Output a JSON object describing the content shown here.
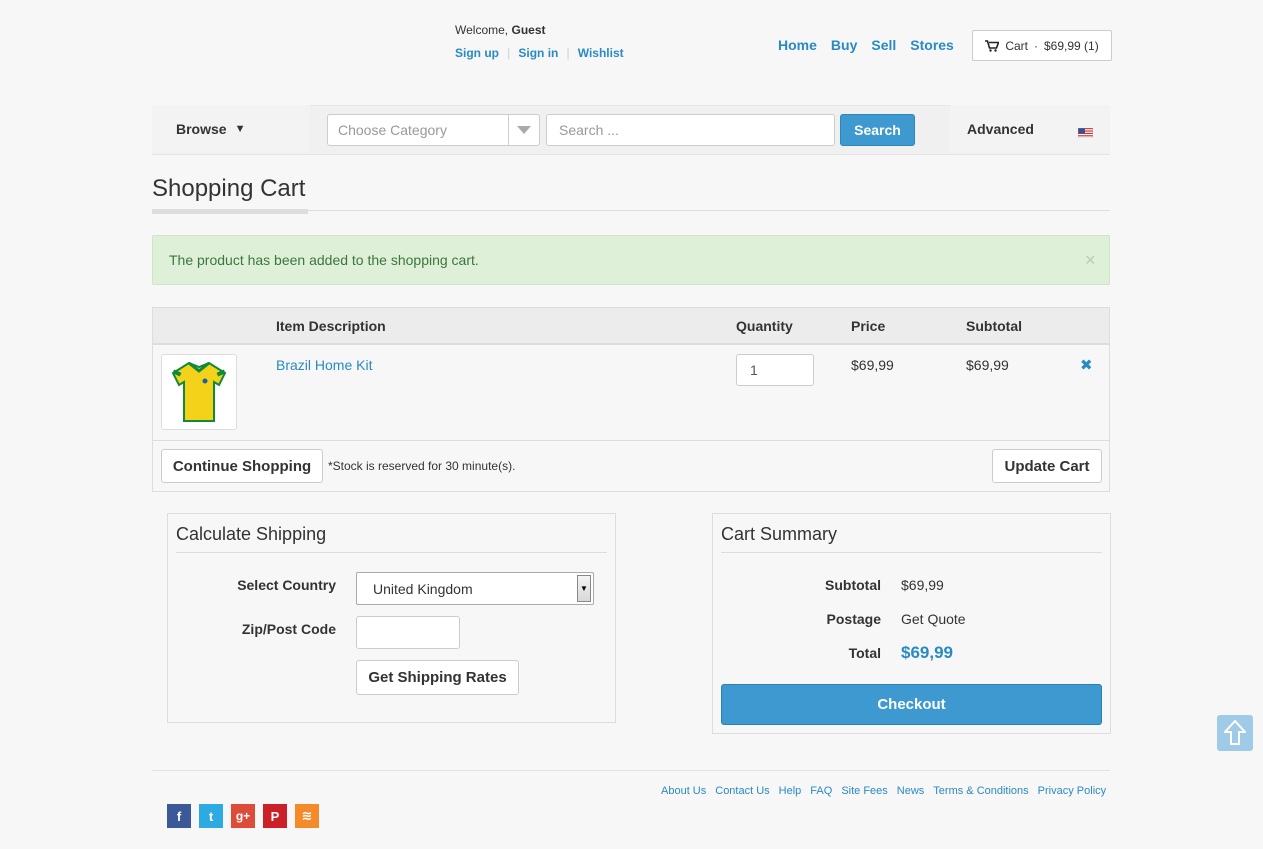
{
  "header": {
    "welcome_prefix": "Welcome,",
    "welcome_user": "Guest",
    "user_links": [
      "Sign up",
      "Sign in",
      "Wishlist"
    ],
    "nav": [
      "Home",
      "Buy",
      "Sell",
      "Stores"
    ],
    "cart_label": "Cart",
    "cart_sep": "·",
    "cart_total": "$69,99 (1)"
  },
  "searchbar": {
    "browse_label": "Browse",
    "browse_arrow": "▼",
    "category_placeholder": "Choose Category",
    "search_placeholder": "Search ...",
    "search_button": "Search",
    "advanced_label": "Advanced",
    "flag_icon": "us-flag-icon"
  },
  "page": {
    "title": "Shopping Cart",
    "alert_text": "The product has been added to the shopping cart.",
    "alert_close": "×"
  },
  "cart": {
    "headers": {
      "item": "Item Description",
      "quantity": "Quantity",
      "price": "Price",
      "subtotal": "Subtotal"
    },
    "items": [
      {
        "name": "Brazil Home Kit",
        "quantity": "1",
        "price": "$69,99",
        "subtotal": "$69,99",
        "remove_icon": "✖"
      }
    ],
    "continue_button": "Continue Shopping",
    "stock_note": "*Stock is reserved for 30 minute(s).",
    "update_button": "Update Cart"
  },
  "shipping": {
    "title": "Calculate Shipping",
    "country_label": "Select Country",
    "country_value": "United Kingdom",
    "zip_label": "Zip/Post Code",
    "zip_value": "",
    "rates_button": "Get Shipping Rates"
  },
  "summary": {
    "title": "Cart Summary",
    "subtotal_label": "Subtotal",
    "subtotal_value": "$69,99",
    "postage_label": "Postage",
    "postage_value": "Get Quote",
    "total_label": "Total",
    "total_value": "$69,99",
    "checkout_button": "Checkout"
  },
  "footer": {
    "links": [
      "About Us",
      "Contact Us",
      "Help",
      "FAQ",
      "Site Fees",
      "News",
      "Terms & Conditions",
      "Privacy Policy"
    ],
    "social": [
      {
        "name": "facebook-icon",
        "glyph": "f",
        "color": "#3b5998"
      },
      {
        "name": "twitter-icon",
        "glyph": "t",
        "color": "#2daae1"
      },
      {
        "name": "google-plus-icon",
        "glyph": "g+",
        "color": "#dd4b39"
      },
      {
        "name": "pinterest-icon",
        "glyph": "P",
        "color": "#cb2027"
      },
      {
        "name": "rss-icon",
        "glyph": "≋",
        "color": "#f58a2a"
      }
    ]
  },
  "colors": {
    "accent": "#3e99d1",
    "link": "#2a8ac4",
    "alert_bg": "#dff0d8",
    "alert_text": "#3c763d"
  }
}
